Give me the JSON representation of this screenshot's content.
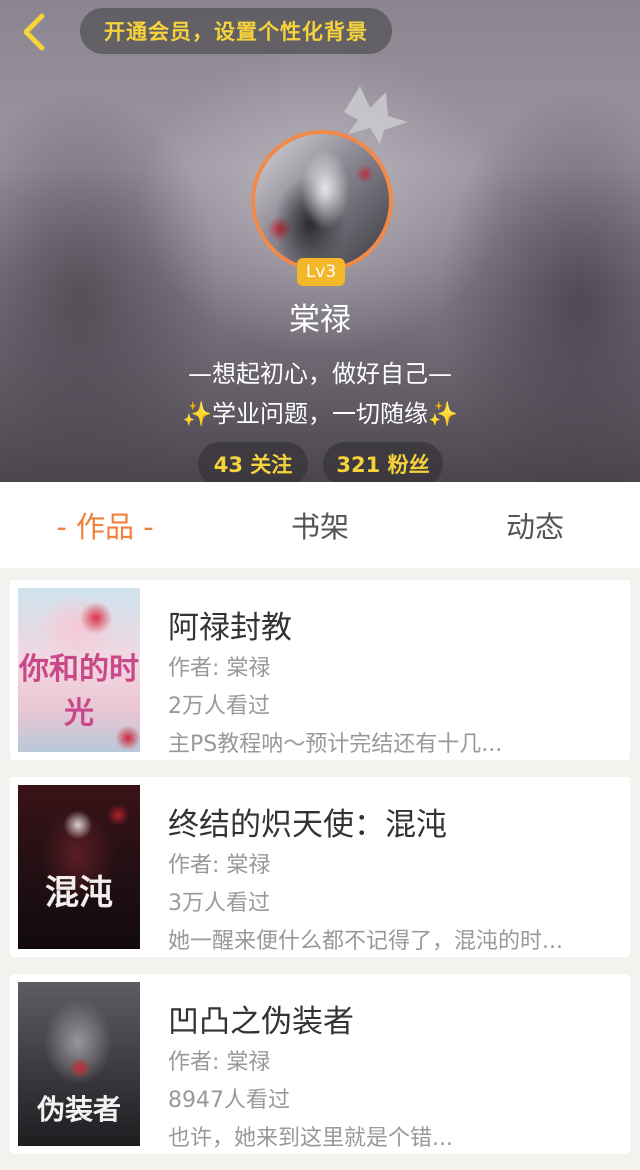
{
  "header": {
    "vip_banner": "开通会员，设置个性化背景",
    "level": "Lv3",
    "username": "棠禄",
    "signature_line1": "—想起初心，做好自己—",
    "signature_line2": "✨学业问题，一切随缘✨",
    "following": "43 关注",
    "followers": "321 粉丝"
  },
  "tabs": [
    {
      "label": "- 作品 -",
      "active": true
    },
    {
      "label": "书架",
      "active": false
    },
    {
      "label": "动态",
      "active": false
    }
  ],
  "books": [
    {
      "title": "阿禄封教",
      "author": "作者: 棠禄",
      "views": "2万人看过",
      "description": "主PS教程呐～预计完结还有十几...",
      "cover_text": "你和的时光"
    },
    {
      "title": "终结的炽天使：混沌",
      "author": "作者: 棠禄",
      "views": "3万人看过",
      "description": "她一醒来便什么都不记得了，混沌的时...",
      "cover_text": "混沌"
    },
    {
      "title": "凹凸之伪装者",
      "author": "作者: 棠禄",
      "views": "8947人看过",
      "description": "也许，她来到这里就是个错...",
      "cover_text": "伪装者"
    }
  ],
  "colors": {
    "accent": "#f0803a",
    "gold": "#f6d33b",
    "level_badge": "#f3b829",
    "avatar_ring": "#f08a4b"
  }
}
